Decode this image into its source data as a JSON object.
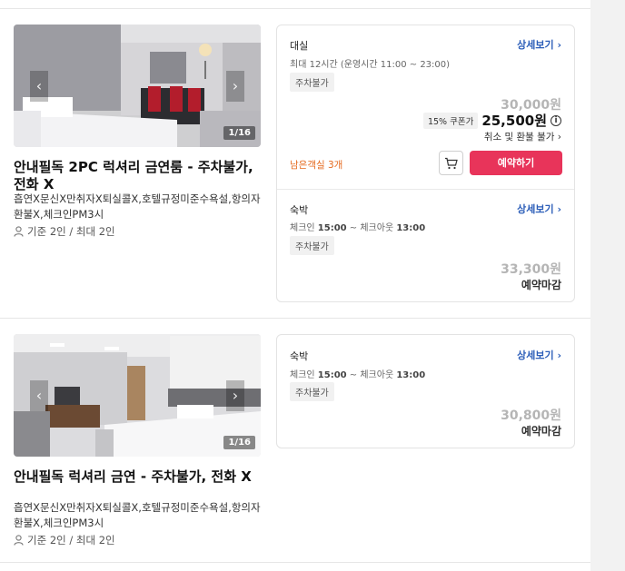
{
  "rooms": [
    {
      "photo": {
        "counter": "1/16",
        "prev_glyph": "‹",
        "next_glyph": "›"
      },
      "title": "안내필독 2PC 럭셔리 금연룸 - 주차불가, 전화 X",
      "desc": "흡연X문신X만취자X퇴실콜X,호텔규정미준수욕설,항의자환불X,체크인PM3시",
      "capacity": "기준 2인 / 최대 2인",
      "options": [
        {
          "type": "대실",
          "detail": "상세보기 ›",
          "time": "최대 12시간 (운영시간 11:00 ~ 23:00)",
          "tag": "주차불가",
          "orig_price": "30,000원",
          "coupon": "15% 쿠폰가",
          "sale_price": "25,500원",
          "info": "i",
          "cancel": "취소 및 환불 불가 ›",
          "remain": "남은객실 3개",
          "reserve": "예약하기"
        },
        {
          "type": "숙박",
          "detail": "상세보기 ›",
          "time_prefix": "체크인 ",
          "checkin": "15:00",
          "time_mid": " ~ 체크아웃 ",
          "checkout": "13:00",
          "tag": "주차불가",
          "orig_price": "33,300원",
          "closed": "예약마감"
        }
      ]
    },
    {
      "photo": {
        "counter": "1/16",
        "prev_glyph": "‹",
        "next_glyph": "›"
      },
      "title": "안내필독 럭셔리 금연 - 주차불가, 전화 X",
      "desc": "흡연X문신X만취자X퇴실콜X,호텔규정미준수욕설,항의자환불X,체크인PM3시",
      "capacity": "기준 2인 / 최대 2인",
      "options": [
        {
          "type": "숙박",
          "detail": "상세보기 ›",
          "time_prefix": "체크인 ",
          "checkin": "15:00",
          "time_mid": " ~ 체크아웃 ",
          "checkout": "13:00",
          "tag": "주차불가",
          "orig_price": "30,800원",
          "closed": "예약마감"
        }
      ]
    }
  ],
  "colors": {
    "accent": "#e8345a",
    "link": "#2b5db8",
    "remain": "#e56a1f",
    "muted_price": "#b5b5b5"
  },
  "icons": {
    "cart": "cart-icon",
    "person": "person-icon",
    "info": "info-icon"
  }
}
